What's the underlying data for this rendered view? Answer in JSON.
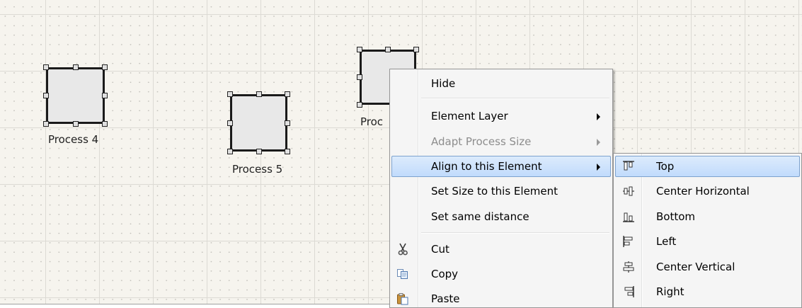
{
  "canvas": {
    "nodes": [
      {
        "label": "Process 4"
      },
      {
        "label": "Process 5"
      },
      {
        "label": "Proc"
      }
    ]
  },
  "context_menu": {
    "items": [
      {
        "label": "Hide"
      },
      {
        "label": "Element Layer",
        "submenu": true
      },
      {
        "label": "Adapt Process Size",
        "submenu": true,
        "disabled": true
      },
      {
        "label": "Align to this Element",
        "submenu": true,
        "highlighted": true
      },
      {
        "label": "Set Size to this Element"
      },
      {
        "label": "Set same distance"
      },
      {
        "label": "Cut",
        "icon": "scissors-icon"
      },
      {
        "label": "Copy",
        "icon": "copy-icon"
      },
      {
        "label": "Paste",
        "icon": "paste-icon"
      }
    ]
  },
  "align_submenu": {
    "items": [
      {
        "label": "Top",
        "icon": "align-top-icon",
        "highlighted": true
      },
      {
        "label": "Center Horizontal",
        "icon": "align-center-horizontal-icon"
      },
      {
        "label": "Bottom",
        "icon": "align-bottom-icon"
      },
      {
        "label": "Left",
        "icon": "align-left-icon"
      },
      {
        "label": "Center Vertical",
        "icon": "align-center-vertical-icon"
      },
      {
        "label": "Right",
        "icon": "align-right-icon"
      }
    ]
  },
  "colors": {
    "canvas_background": "#f6f4ee",
    "menu_background": "#f5f5f5",
    "highlight": "#c1dbfc",
    "highlight_border": "#7da2ce",
    "disabled_text": "#8d8d8d"
  }
}
